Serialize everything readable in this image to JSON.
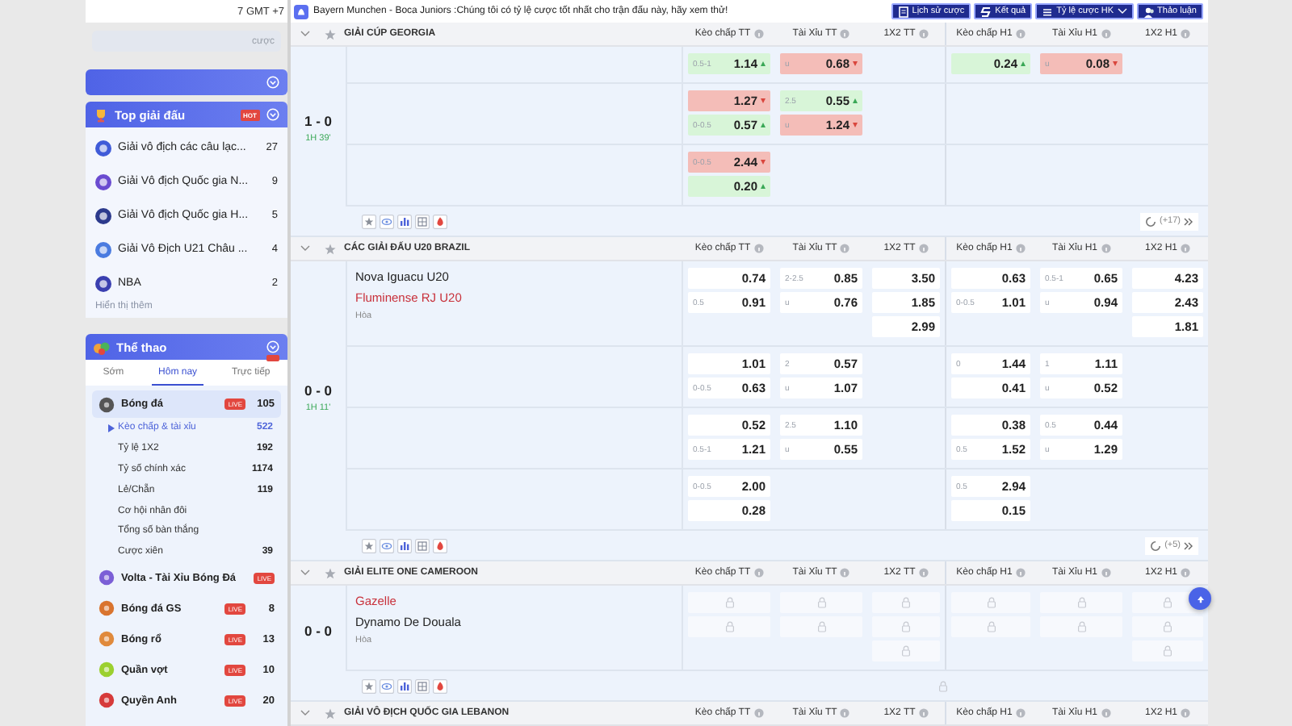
{
  "topbar": {
    "timezone": "7 GMT +7"
  },
  "sidebar": {
    "search": {
      "placeholder": "cược"
    },
    "top_leagues": {
      "title": "Top giải đấu",
      "badge": "HOT",
      "more": "Hiển thị thêm",
      "items": [
        {
          "name": "Giải vô địch các câu lạc...",
          "count": "27"
        },
        {
          "name": "Giải Vô địch Quốc gia N...",
          "count": "9"
        },
        {
          "name": "Giải Vô địch Quốc gia H...",
          "count": "5"
        },
        {
          "name": "Giải Vô Địch U21 Châu ...",
          "count": "4"
        },
        {
          "name": "NBA",
          "count": "2"
        }
      ]
    },
    "sports": {
      "title": "Thể thao",
      "tabs": [
        {
          "label": "Sớm",
          "selected": false
        },
        {
          "label": "Hôm nay",
          "selected": true
        },
        {
          "label": "Trực tiếp",
          "selected": false
        }
      ],
      "items": [
        {
          "name": "Bóng đá",
          "badge": "LIVE",
          "count": "105",
          "expanded": true,
          "children": [
            {
              "name": "Kèo chấp & tài xỉu",
              "count": "522",
              "selected": true
            },
            {
              "name": "Tỷ lệ 1X2",
              "count": "192",
              "selected": false
            },
            {
              "name": "Tỷ số chính xác",
              "count": "1174",
              "selected": false
            },
            {
              "name": "Lẻ/Chẵn",
              "count": "119",
              "selected": false
            },
            {
              "name": "Cơ hội nhân đôi",
              "selected": false
            },
            {
              "name": "Tổng số bàn thắng",
              "selected": false
            },
            {
              "name": "Cược xiên",
              "count": "39",
              "selected": false
            }
          ]
        },
        {
          "name": "Volta - Tài Xỉu Bóng Đá",
          "badge": "LIVE",
          "expanded": false
        },
        {
          "name": "Bóng đá GS",
          "badge": "LIVE",
          "count": "8",
          "expanded": false
        },
        {
          "name": "Bóng rổ",
          "badge": "LIVE",
          "count": "13",
          "expanded": false
        },
        {
          "name": "Quần vợt",
          "badge": "LIVE",
          "count": "10",
          "expanded": false
        },
        {
          "name": "Quyền Anh",
          "badge": "LIVE",
          "count": "20",
          "expanded": false
        }
      ]
    }
  },
  "notice": "Bayern Munchen - Boca Juniors :Chúng tôi có tỷ lệ cược tốt nhất cho trận đấu này, hãy xem thử!",
  "toolbar": [
    {
      "label": "Lịch sử cược",
      "dropdown": false
    },
    {
      "label": "Kết quả",
      "dropdown": false
    },
    {
      "label": "Tỷ lệ cược HK",
      "dropdown": true
    },
    {
      "label": "Thảo luận",
      "dropdown": false
    }
  ],
  "leagues": [
    {
      "name": "GIẢI CÚP GEORGIA",
      "columns": [
        "Kèo chấp TT",
        "Tài Xỉu TT",
        "1X2 TT",
        "Kèo chấp H1",
        "Tài Xỉu H1",
        "1X2 H1"
      ],
      "more": "(+17)",
      "matches": [
        {
          "score": "1 - 0",
          "time": "1H 39'",
          "rows": [
            {
              "cells": [
                [
                  {
                    "kind": "odds",
                    "line": "0.5-1",
                    "value": "1.14",
                    "rising": true
                  }
                ],
                [
                  {
                    "kind": "odds",
                    "line": "u",
                    "value": "0.68",
                    "rising": false
                  }
                ],
                [],
                [
                  {
                    "kind": "odds",
                    "value": "0.24",
                    "rising": true
                  }
                ],
                [
                  {
                    "kind": "odds",
                    "line": "u",
                    "value": "0.08",
                    "rising": false
                  }
                ],
                []
              ]
            },
            {
              "cells": [
                [
                  {
                    "kind": "odds",
                    "value": "1.27",
                    "rising": false
                  },
                  {
                    "kind": "odds",
                    "line": "0-0.5",
                    "value": "0.57",
                    "rising": true
                  }
                ],
                [
                  {
                    "kind": "odds",
                    "line": "2.5",
                    "value": "0.55",
                    "rising": true
                  },
                  {
                    "kind": "odds",
                    "line": "u",
                    "value": "1.24",
                    "rising": false
                  }
                ],
                [],
                [],
                [],
                []
              ]
            },
            {
              "cells": [
                [
                  {
                    "kind": "odds",
                    "line": "0-0.5",
                    "value": "2.44",
                    "rising": false
                  },
                  {
                    "kind": "odds",
                    "value": "0.20",
                    "rising": true
                  }
                ],
                [],
                [],
                [],
                [],
                []
              ]
            }
          ]
        }
      ]
    },
    {
      "name": "CÁC GIẢI ĐẤU U20 BRAZIL",
      "columns": [
        "Kèo chấp TT",
        "Tài Xỉu TT",
        "1X2 TT",
        "Kèo chấp H1",
        "Tài Xỉu H1",
        "1X2 H1"
      ],
      "more": "(+5)",
      "matches": [
        {
          "score": "0 - 0",
          "time": "1H 11'",
          "teams": [
            {
              "name": "Nova Iguacu U20",
              "favorite": false
            },
            {
              "name": "Fluminense RJ U20",
              "favorite": true
            }
          ],
          "draw": "Hòa",
          "rows": [
            {
              "cells": [
                [
                  {
                    "kind": "odds",
                    "value": "0.74"
                  },
                  {
                    "kind": "odds",
                    "line": "0.5",
                    "value": "0.91"
                  }
                ],
                [
                  {
                    "kind": "odds",
                    "line": "2-2.5",
                    "value": "0.85"
                  },
                  {
                    "kind": "odds",
                    "line": "u",
                    "value": "0.76"
                  }
                ],
                [
                  {
                    "kind": "odds",
                    "value": "3.50"
                  },
                  {
                    "kind": "odds",
                    "value": "1.85"
                  },
                  {
                    "kind": "odds",
                    "value": "2.99"
                  }
                ],
                [
                  {
                    "kind": "odds",
                    "value": "0.63"
                  },
                  {
                    "kind": "odds",
                    "line": "0-0.5",
                    "value": "1.01"
                  }
                ],
                [
                  {
                    "kind": "odds",
                    "line": "0.5-1",
                    "value": "0.65"
                  },
                  {
                    "kind": "odds",
                    "line": "u",
                    "value": "0.94"
                  }
                ],
                [
                  {
                    "kind": "odds",
                    "value": "4.23"
                  },
                  {
                    "kind": "odds",
                    "value": "2.43"
                  },
                  {
                    "kind": "odds",
                    "value": "1.81"
                  }
                ]
              ]
            },
            {
              "cells": [
                [
                  {
                    "kind": "odds",
                    "value": "1.01"
                  },
                  {
                    "kind": "odds",
                    "line": "0-0.5",
                    "value": "0.63"
                  }
                ],
                [
                  {
                    "kind": "odds",
                    "line": "2",
                    "value": "0.57"
                  },
                  {
                    "kind": "odds",
                    "line": "u",
                    "value": "1.07"
                  }
                ],
                [],
                [
                  {
                    "kind": "odds",
                    "line": "0",
                    "value": "1.44"
                  },
                  {
                    "kind": "odds",
                    "value": "0.41"
                  }
                ],
                [
                  {
                    "kind": "odds",
                    "line": "1",
                    "value": "1.11"
                  },
                  {
                    "kind": "odds",
                    "line": "u",
                    "value": "0.52"
                  }
                ],
                []
              ]
            },
            {
              "cells": [
                [
                  {
                    "kind": "odds",
                    "value": "0.52"
                  },
                  {
                    "kind": "odds",
                    "line": "0.5-1",
                    "value": "1.21"
                  }
                ],
                [
                  {
                    "kind": "odds",
                    "line": "2.5",
                    "value": "1.10"
                  },
                  {
                    "kind": "odds",
                    "line": "u",
                    "value": "0.55"
                  }
                ],
                [],
                [
                  {
                    "kind": "odds",
                    "value": "0.38"
                  },
                  {
                    "kind": "odds",
                    "line": "0.5",
                    "value": "1.52"
                  }
                ],
                [
                  {
                    "kind": "odds",
                    "line": "0.5",
                    "value": "0.44"
                  },
                  {
                    "kind": "odds",
                    "line": "u",
                    "value": "1.29"
                  }
                ],
                []
              ]
            },
            {
              "cells": [
                [
                  {
                    "kind": "odds",
                    "line": "0-0.5",
                    "value": "2.00"
                  },
                  {
                    "kind": "odds",
                    "value": "0.28"
                  }
                ],
                [],
                [],
                [
                  {
                    "kind": "odds",
                    "line": "0.5",
                    "value": "2.94"
                  },
                  {
                    "kind": "odds",
                    "value": "0.15"
                  }
                ],
                [],
                []
              ]
            }
          ]
        }
      ]
    },
    {
      "name": "GIẢI ELITE ONE CAMEROON",
      "columns": [
        "Kèo chấp TT",
        "Tài Xỉu TT",
        "1X2 TT",
        "Kèo chấp H1",
        "Tài Xỉu H1",
        "1X2 H1"
      ],
      "locked": true,
      "matches": [
        {
          "score": "0 - 0",
          "teams": [
            {
              "name": "Gazelle",
              "favorite": true
            },
            {
              "name": "Dynamo De Douala",
              "favorite": false
            }
          ],
          "draw": "Hòa",
          "rows": [
            {
              "cells": [
                [
                  {
                    "kind": "locked"
                  },
                  {
                    "kind": "locked"
                  }
                ],
                [
                  {
                    "kind": "locked"
                  },
                  {
                    "kind": "locked"
                  }
                ],
                [
                  {
                    "kind": "locked"
                  },
                  {
                    "kind": "locked"
                  },
                  {
                    "kind": "locked"
                  }
                ],
                [
                  {
                    "kind": "locked"
                  },
                  {
                    "kind": "locked"
                  }
                ],
                [
                  {
                    "kind": "locked"
                  },
                  {
                    "kind": "locked"
                  }
                ],
                [
                  {
                    "kind": "locked"
                  },
                  {
                    "kind": "locked"
                  },
                  {
                    "kind": "locked"
                  }
                ]
              ]
            }
          ]
        }
      ]
    },
    {
      "name": "GIẢI VÔ ĐỊCH QUỐC GIA LEBANON",
      "columns": [
        "Kèo chấp TT",
        "Tài Xỉu TT",
        "1X2 TT",
        "Kèo chấp H1",
        "Tài Xỉu H1",
        "1X2 H1"
      ]
    }
  ]
}
